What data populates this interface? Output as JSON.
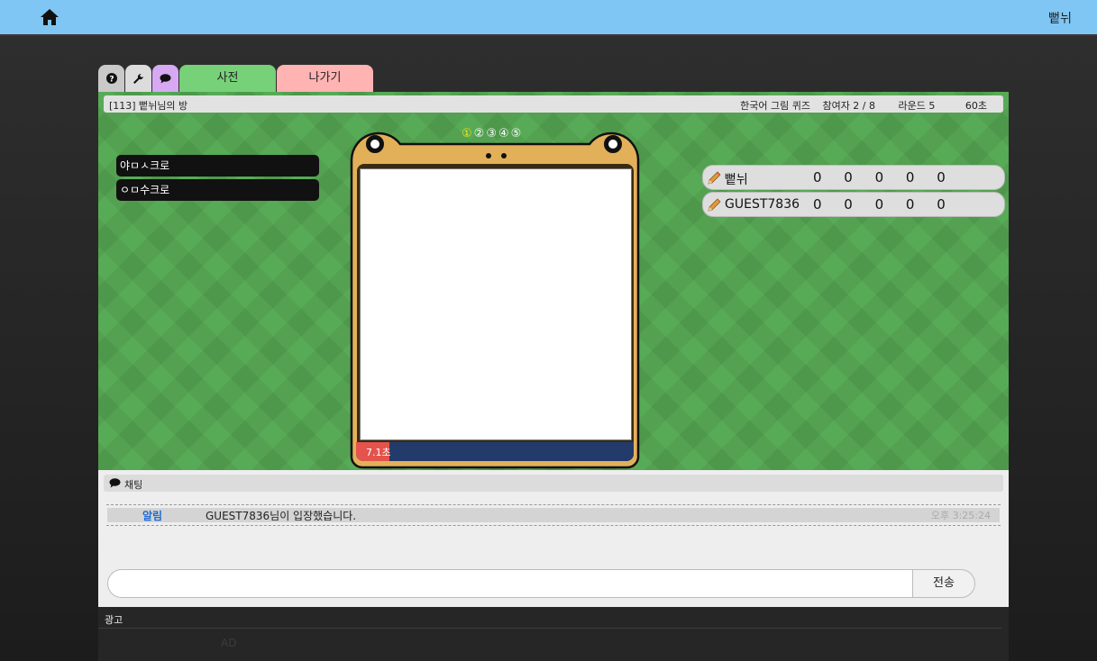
{
  "header": {
    "home_icon": "home-icon",
    "user_name": "뻩뉘"
  },
  "tabs": {
    "help_icon": "question-icon",
    "settings_icon": "wrench-icon",
    "chat_icon": "chat-bubble-icon",
    "dictionary_label": "사전",
    "exit_label": "나가기"
  },
  "room": {
    "title": "[113]  뻩뉘님의 방",
    "mode": "한국어 그림 퀴즈",
    "participants": "참여자 2 / 8",
    "round": "라운드 5",
    "time_limit": "60초"
  },
  "hints": [
    "야ㅁㅅ크로",
    "ㅇㅁ수크로"
  ],
  "board": {
    "rounds": [
      "①",
      "②",
      "③",
      "④",
      "⑤"
    ],
    "active_round": 1,
    "timer_text": "7.1초",
    "timer_fraction": 0.12,
    "colors": {
      "frame": "#e3b05a",
      "timer": "#e4534c",
      "timer_bg": "#233b6a"
    }
  },
  "players": [
    {
      "name": "뻩뉘",
      "score": "0 0 0 0 0"
    },
    {
      "name": "GUEST7836",
      "score": "0 0 0 0 0"
    }
  ],
  "chat": {
    "header": "채팅",
    "messages": [
      {
        "sender": "알림",
        "text": "GUEST7836님이 입장했습니다.",
        "time": "오후 3:25:24"
      }
    ],
    "input_placeholder": "",
    "send_label": "전송"
  },
  "ad": {
    "title": "광고",
    "text": "AD"
  }
}
